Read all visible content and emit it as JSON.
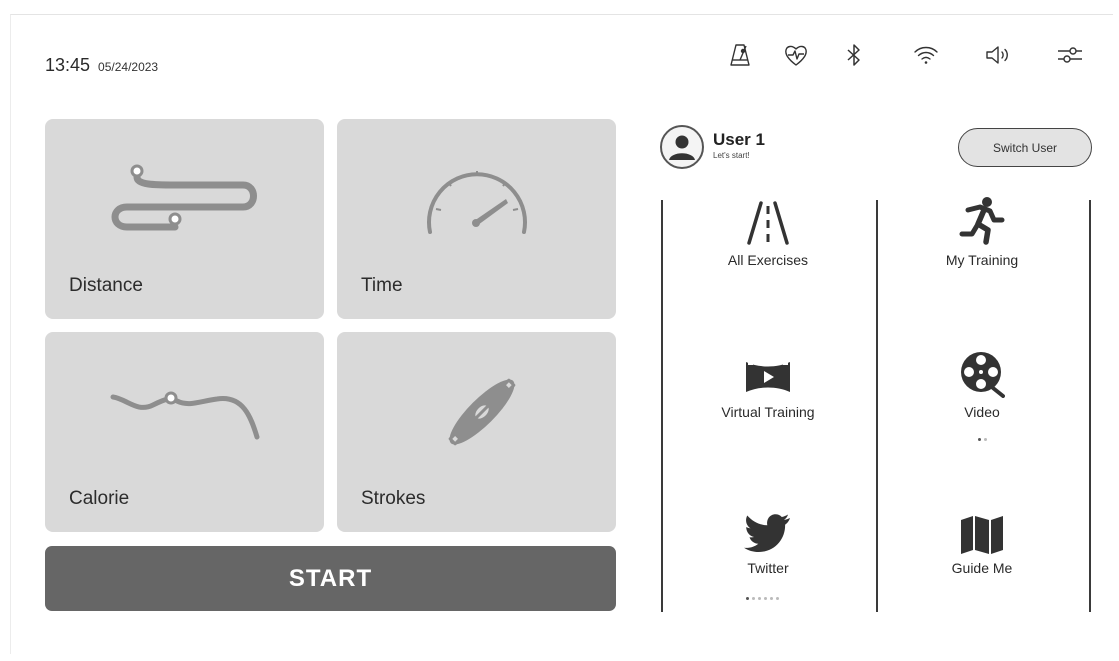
{
  "status_bar": {
    "time": "13:45",
    "date": "05/24/2023",
    "icons": [
      "metronome-icon",
      "heart-rate-icon",
      "bluetooth-icon",
      "wifi-icon",
      "volume-icon",
      "settings-sliders-icon"
    ]
  },
  "metrics": {
    "distance_label": "Distance",
    "time_label": "Time",
    "calorie_label": "Calorie",
    "strokes_label": "Strokes"
  },
  "start_label": "START",
  "user": {
    "name": "User 1",
    "subtitle": "Let's start!",
    "switch_label": "Switch User"
  },
  "menu": {
    "all_exercises": "All Exercises",
    "my_training": "My Training",
    "virtual_training": "Virtual Training",
    "video": "Video",
    "twitter": "Twitter",
    "guide_me": "Guide Me"
  },
  "colors": {
    "tile_bg": "#d9d9d9",
    "start_bg": "#666666",
    "icon_dark": "#333333"
  }
}
